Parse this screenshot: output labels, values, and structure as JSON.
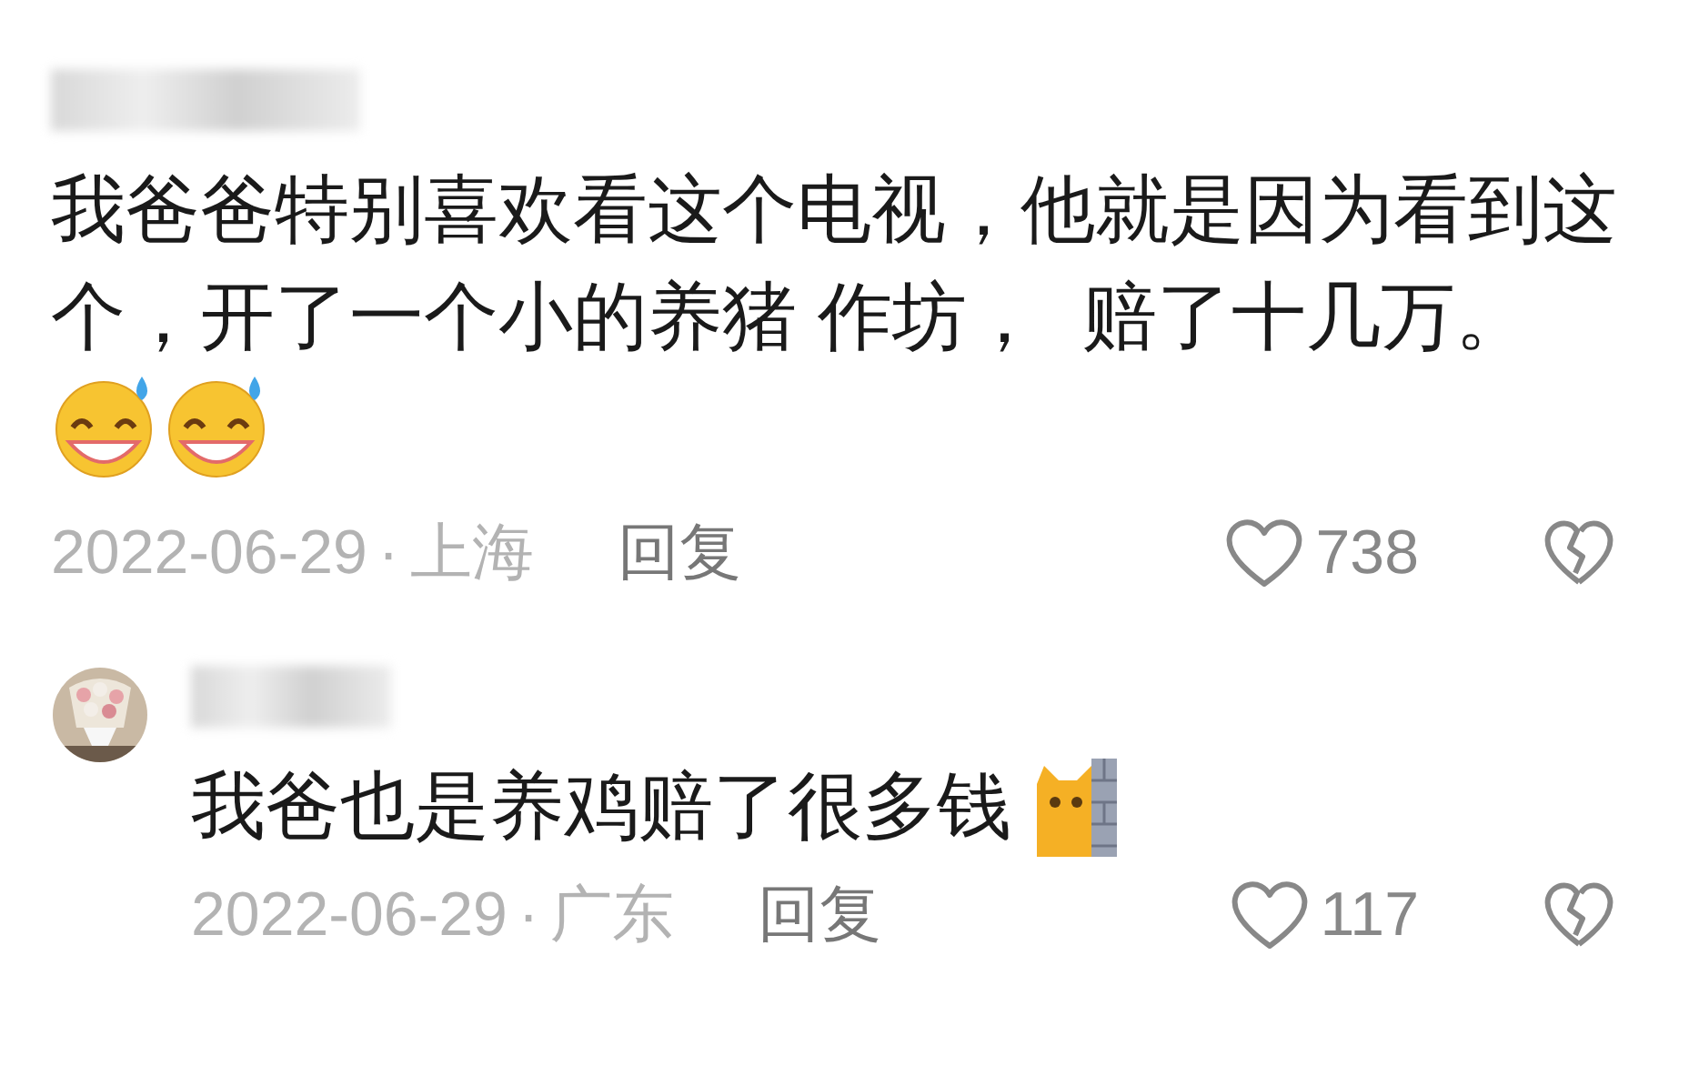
{
  "comments": [
    {
      "kind": "top",
      "text": "我爸爸特别喜欢看这个电视，他就是因为看到这个，开了一个小的养猪 作坊，  赔了十几万。",
      "emojis": [
        {
          "kind": "grin-sweat"
        },
        {
          "kind": "grin-sweat"
        }
      ],
      "date": "2022-06-29",
      "separator": "·",
      "location": "上海",
      "reply": "回复",
      "likes": "738"
    },
    {
      "kind": "reply",
      "text": "我爸也是养鸡赔了很多钱",
      "emojis": [
        {
          "kind": "cat-wall"
        }
      ],
      "date": "2022-06-29",
      "separator": "·",
      "location": "广东",
      "reply": "回复",
      "likes": "117"
    }
  ]
}
